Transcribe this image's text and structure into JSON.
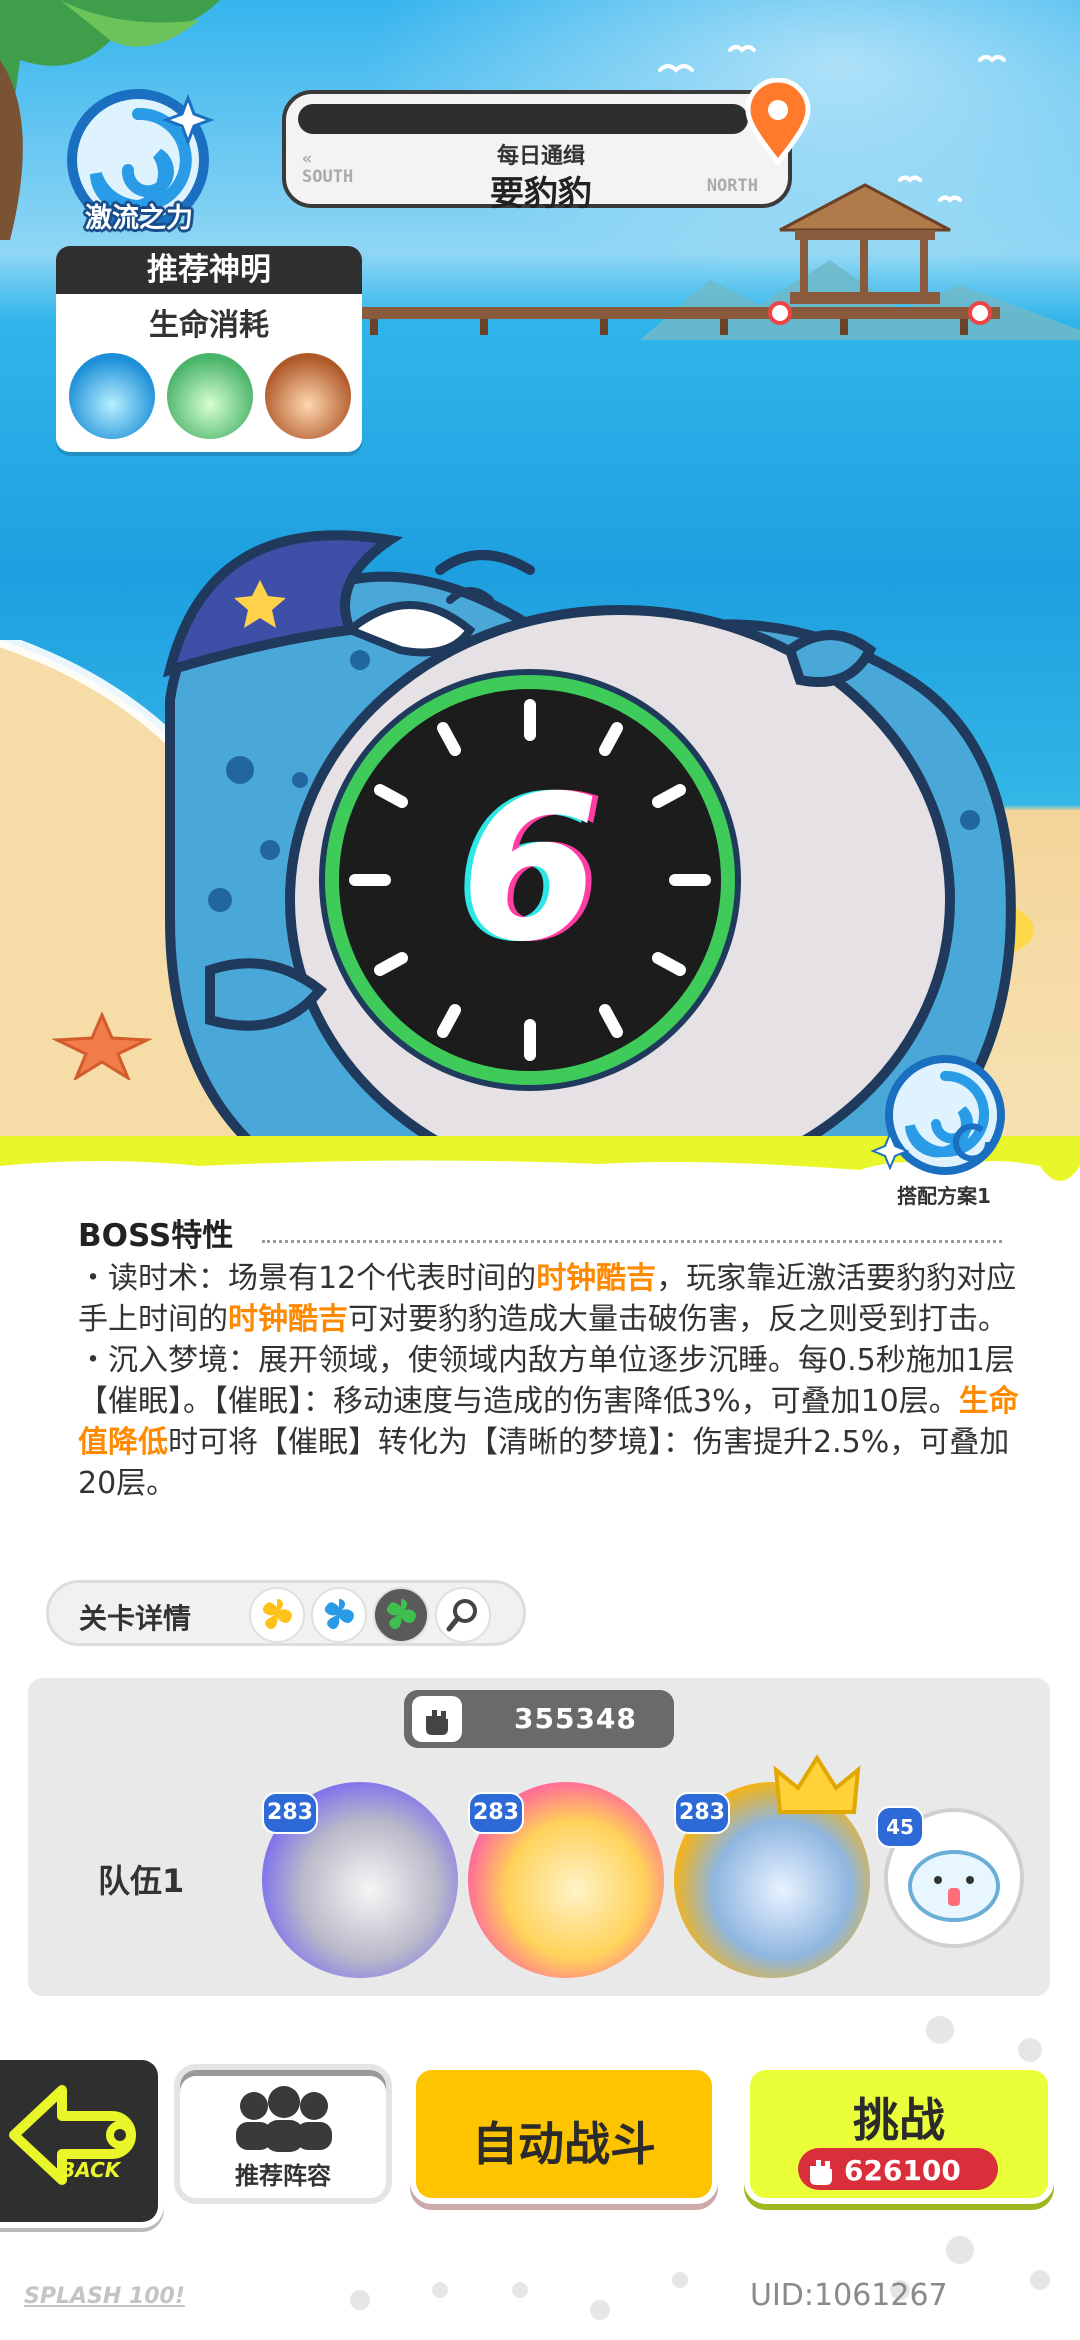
{
  "element": {
    "label": "激流之力",
    "icon": "whirlpool-icon"
  },
  "wanted": {
    "subtitle": "每日通缉",
    "title": "要豹豹",
    "south": "SOUTH",
    "north": "NORTH"
  },
  "recommended_god": {
    "header": "推荐神明",
    "subtitle": "生命消耗"
  },
  "boss_clock": {
    "number": "6"
  },
  "plan": {
    "label": "搭配方案1"
  },
  "boss_traits": {
    "title": "BOSS特性",
    "p1_a": "・读时术：场景有12个代表时间的",
    "p1_hl1": "时钟酷吉",
    "p1_b": "，玩家靠近激活要豹豹对应手上时间的",
    "p1_hl2": "时钟酷吉",
    "p1_c": "可对要豹豹造成大量击破伤害，反之则受到打击。",
    "p2_a": "・沉入梦境：展开领域，使领域内敌方单位逐步沉睡。每0.5秒施加1层【催眠】。【催眠】：移动速度与造成的伤害降低3%，可叠加10层。",
    "p2_hl": "生命值降低",
    "p2_b": "时可将【催眠】转化为【清晰的梦境】：伤害提升2.5%，可叠加20层。"
  },
  "stage_detail": {
    "label": "关卡详情"
  },
  "team": {
    "power": "355348",
    "label": "队伍1",
    "heroes": [
      {
        "level": "283",
        "color": "#7a6cf0"
      },
      {
        "level": "283",
        "color": "#ff5fa0"
      },
      {
        "level": "283",
        "color": "#ffb300"
      }
    ],
    "pet_level": "45"
  },
  "buttons": {
    "back": "BACK",
    "recommended_lineup": "推荐阵容",
    "auto_battle": "自动战斗",
    "challenge": "挑战",
    "challenge_cost": "626100"
  },
  "footer": {
    "logo": "SPLASH 100!",
    "uid": "UID:1061267"
  }
}
